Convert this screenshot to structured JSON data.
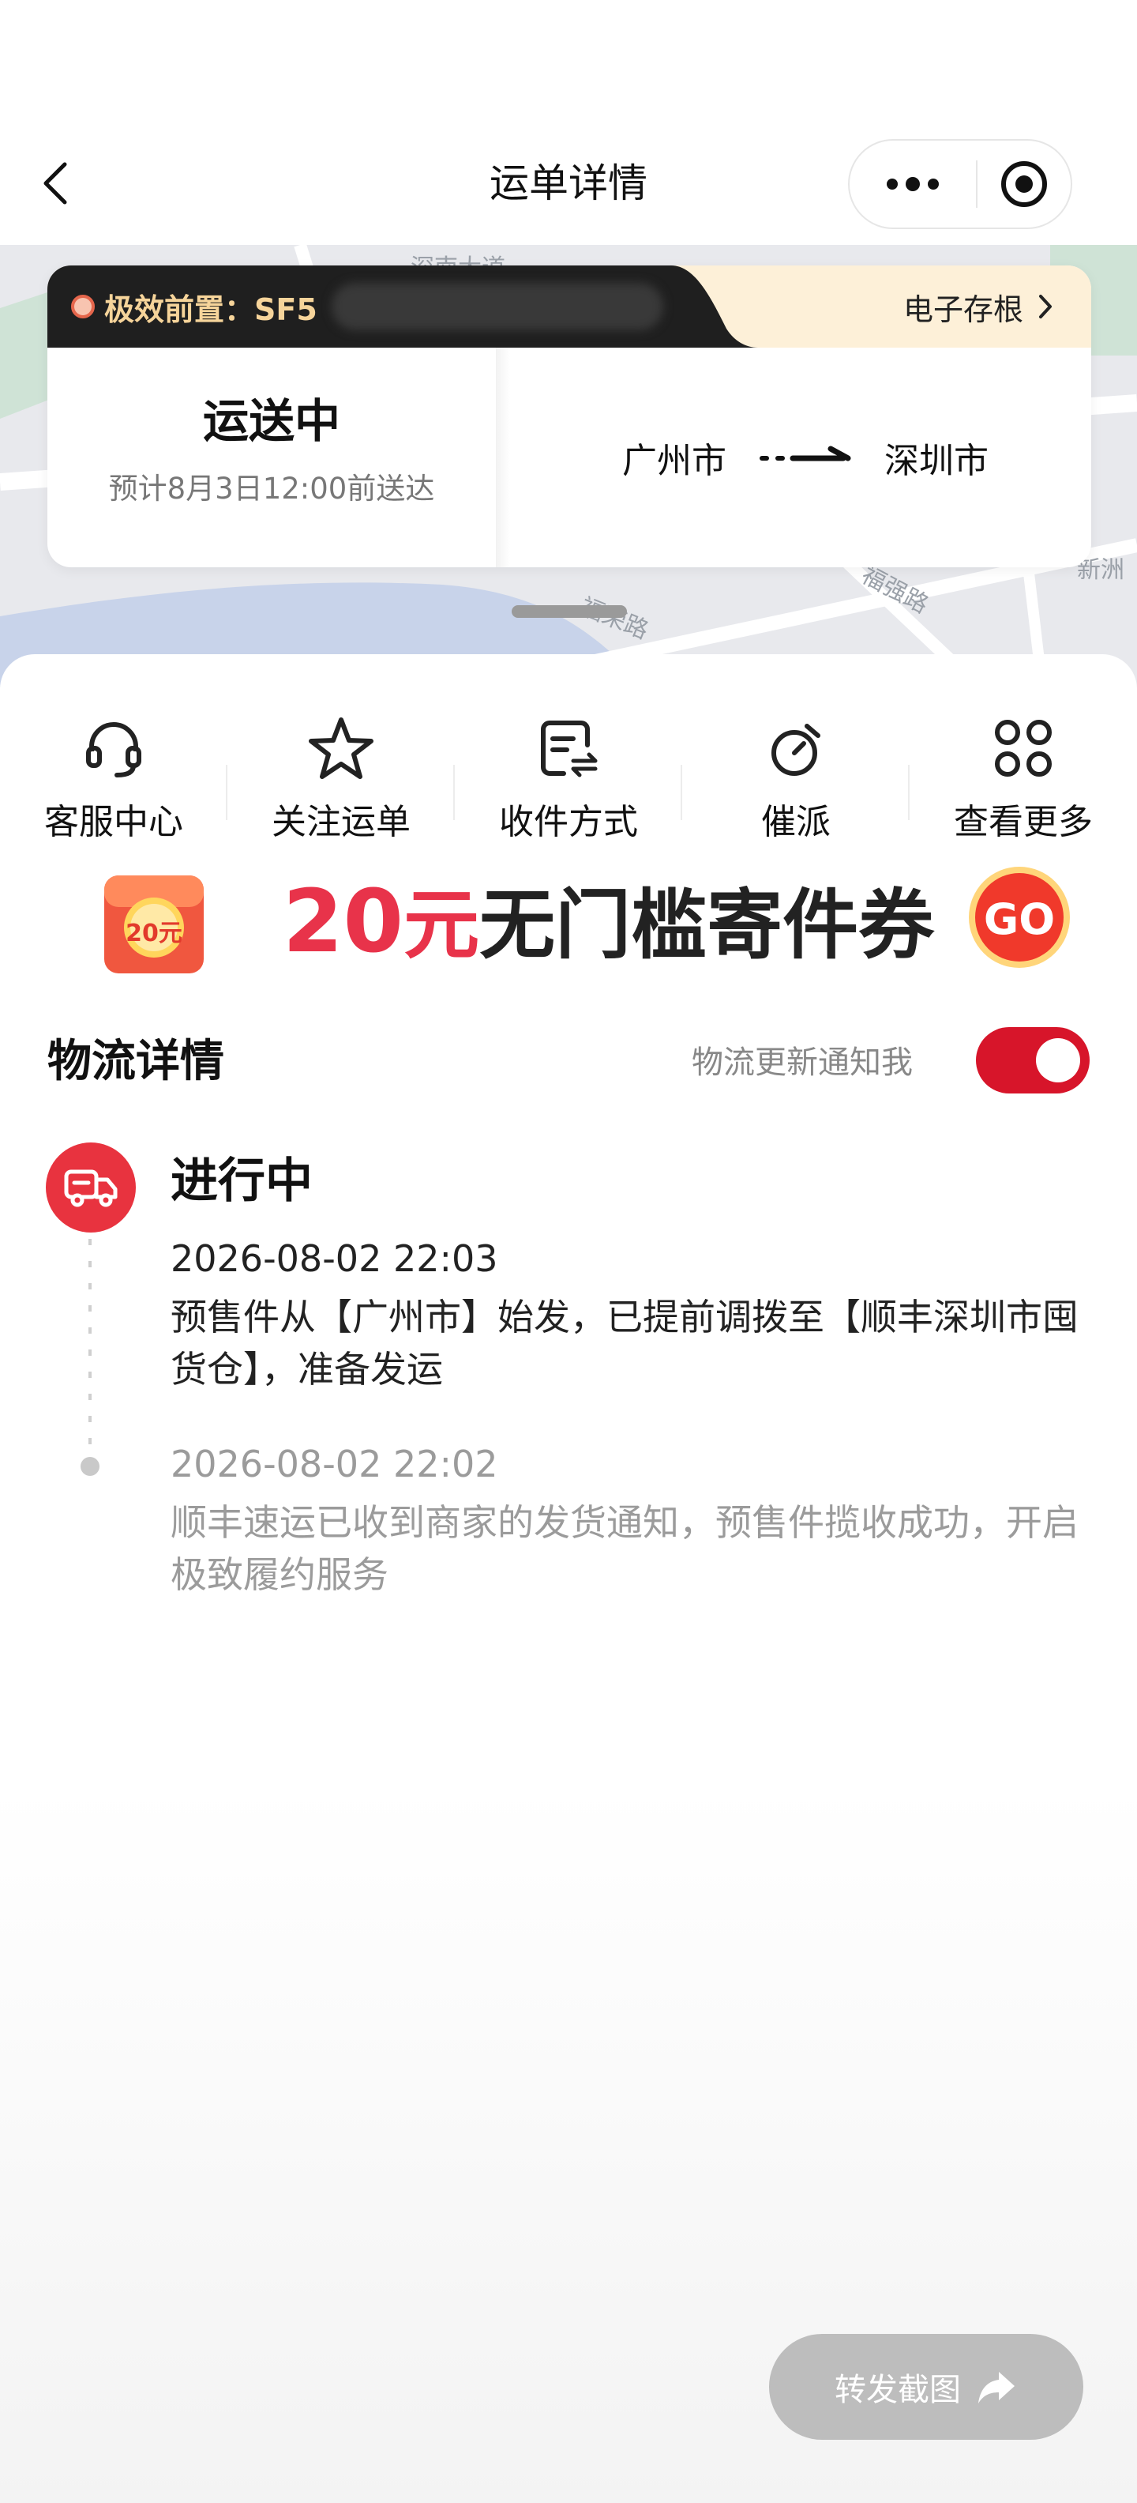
{
  "nav": {
    "title": "运单详情",
    "back_icon": "back-chevron-icon",
    "more_icon": "more-dots-icon",
    "target_icon": "target-circle-icon"
  },
  "map": {
    "labels": [
      "深南大道",
      "福强路",
      "福荣路",
      "新洲"
    ]
  },
  "status_card": {
    "waybill_label": "极效前置：SF5",
    "receipt_label": "电子存根",
    "status": "运送中",
    "eta": "预计8月3日12:00前送达",
    "origin": "广州市",
    "destination": "深圳市"
  },
  "actions": [
    {
      "label": "客服中心",
      "icon": "headset-icon"
    },
    {
      "label": "关注运单",
      "icon": "star-icon"
    },
    {
      "label": "收件方式",
      "icon": "receive-method-icon"
    },
    {
      "label": "催派",
      "icon": "stopwatch-icon"
    },
    {
      "label": "查看更多",
      "icon": "grid-more-icon"
    }
  ],
  "coupon": {
    "badge_text": "20元",
    "amount": "20",
    "unit": "元",
    "text": "无门槛寄件券",
    "go_label": "GO"
  },
  "logistics": {
    "title": "物流详情",
    "notify_label": "物流更新通知我",
    "notify_enabled": true,
    "state": "进行中",
    "events": [
      {
        "time": "2026-08-02 22:03",
        "desc": "预售件从【广州市】始发，已提前调拨至【顺丰深圳市囤货仓】，准备发运"
      },
      {
        "time": "2026-08-02 22:02",
        "desc": "顺丰速运已收到商家的发货通知，预售件揽收成功，开启极致履约服务"
      }
    ]
  },
  "share": {
    "label": "转发截图"
  },
  "colors": {
    "accent_red": "#e8334a",
    "toggle_red": "#d7152a",
    "header_gold": "#f6d49a"
  }
}
